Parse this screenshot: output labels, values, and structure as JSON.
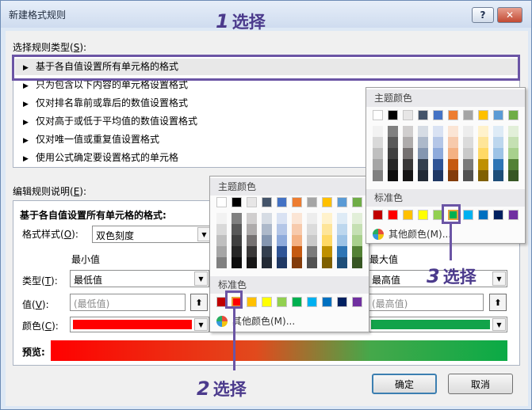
{
  "window": {
    "title": "新建格式规则",
    "help": "?",
    "close": "✕"
  },
  "rule_type": {
    "label": "选择规则类型(",
    "key": "S",
    "tail": "):",
    "items": [
      "基于各自值设置所有单元格的格式",
      "只为包含以下内容的单元格设置格式",
      "仅对排名靠前或靠后的数值设置格式",
      "仅对高于或低于平均值的数值设置格式",
      "仅对唯一值或重复值设置格式",
      "使用公式确定要设置格式的单元格"
    ],
    "selected_index": 0
  },
  "edit_desc": {
    "label": "编辑规则说明(",
    "key": "E",
    "tail": "):",
    "heading": "基于各自值设置所有单元格的格式:",
    "format_style_label": "格式样式(",
    "format_style_key": "O",
    "format_style_tail": "):",
    "format_style_value": "双色刻度",
    "min_header": "最小值",
    "max_header": "最大值",
    "type_label": "类型(",
    "type_key": "T",
    "type_tail": "):",
    "value_label": "值(",
    "value_key": "V",
    "value_tail": "):",
    "color_label": "颜色(",
    "color_key": "C",
    "color_tail": "):",
    "min_type": "最低值",
    "max_type": "最高值",
    "min_value": "(最低值)",
    "max_value": "(最高值)",
    "min_color": "#ff0000",
    "max_color": "#12a34a",
    "preview_label": "预览:"
  },
  "buttons": {
    "ok": "确定",
    "cancel": "取消"
  },
  "palette": {
    "theme_label": "主题颜色",
    "standard_label": "标准色",
    "more_colors": "其他颜色(M)...",
    "theme_colors": [
      "#ffffff",
      "#000000",
      "#e7e6e6",
      "#44546a",
      "#4472c4",
      "#ed7d31",
      "#a5a5a5",
      "#ffc000",
      "#5b9bd5",
      "#70ad47"
    ],
    "theme_shades": [
      [
        "#f2f2f2",
        "#d9d9d9",
        "#bfbfbf",
        "#a6a6a6",
        "#808080"
      ],
      [
        "#808080",
        "#595959",
        "#404040",
        "#262626",
        "#0d0d0d"
      ],
      [
        "#d0cece",
        "#aeabab",
        "#757171",
        "#3a3838",
        "#171616"
      ],
      [
        "#d6dce4",
        "#adb9ca",
        "#8496b0",
        "#333f4f",
        "#222a35"
      ],
      [
        "#d9e2f3",
        "#b4c6e7",
        "#8eaadb",
        "#2f5496",
        "#1f3864"
      ],
      [
        "#fbe5d5",
        "#f7caac",
        "#f4b183",
        "#c55a11",
        "#833c0b"
      ],
      [
        "#ededed",
        "#dbdbdb",
        "#c9c9c9",
        "#7b7b7b",
        "#525252"
      ],
      [
        "#fff2cc",
        "#fee599",
        "#ffd965",
        "#bf9000",
        "#7f6000"
      ],
      [
        "#deebf6",
        "#bdd7ee",
        "#9dc3e6",
        "#2e75b5",
        "#1e4e79"
      ],
      [
        "#e2efd9",
        "#c5e0b3",
        "#a8d08d",
        "#538135",
        "#375623"
      ]
    ],
    "standard_colors": [
      "#c00000",
      "#ff0000",
      "#ffc000",
      "#ffff00",
      "#92d050",
      "#00b050",
      "#00b0f0",
      "#0070c0",
      "#002060",
      "#7030a0"
    ]
  },
  "callouts": {
    "c1": {
      "num": "1",
      "text": "选择"
    },
    "c2": {
      "num": "2",
      "text": "选择"
    },
    "c3": {
      "num": "3",
      "text": "选择"
    }
  }
}
